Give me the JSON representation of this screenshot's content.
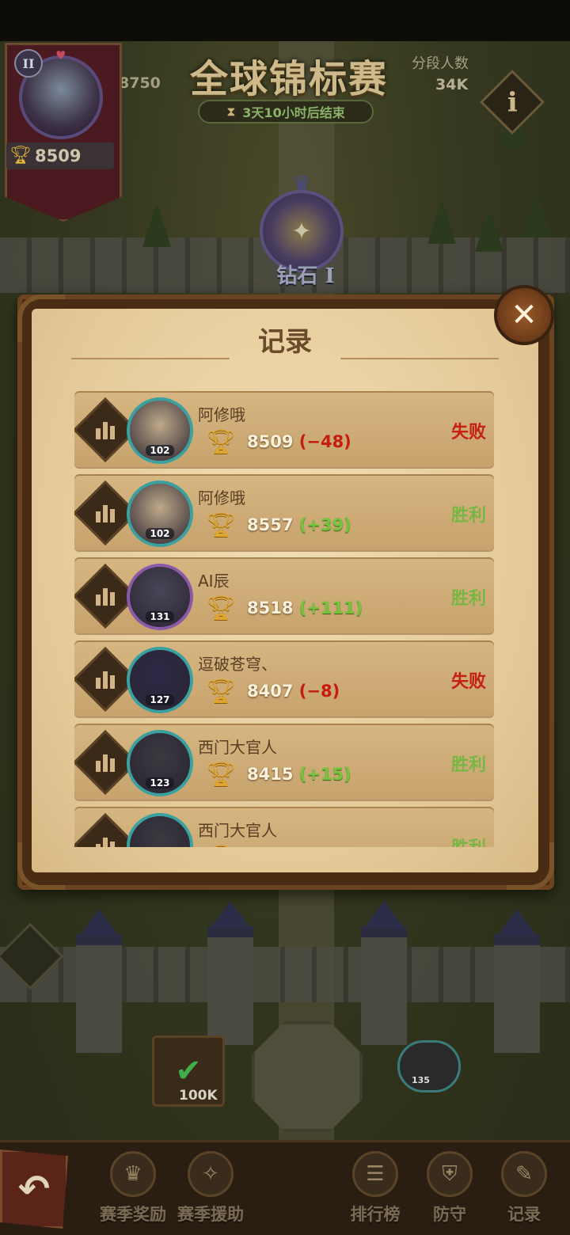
{
  "header": {
    "title": "全球锦标赛",
    "score_left": "8750",
    "rank_label": "分段人数",
    "rank_value": "34K",
    "timer": "3天10小时后结束"
  },
  "player": {
    "level_roman": "II",
    "trophies": "8509"
  },
  "league": {
    "name": "钻石 I"
  },
  "modal": {
    "title": "记录"
  },
  "records": [
    {
      "name": "阿修哦",
      "level": "102",
      "score": "8509",
      "delta": "(−48)",
      "delta_sign": "neg",
      "result": "失败",
      "avatar_color": "#bfa98a",
      "ring_color": "#3aa0a0"
    },
    {
      "name": "阿修哦",
      "level": "102",
      "score": "8557",
      "delta": "(+39)",
      "delta_sign": "pos",
      "result": "胜利",
      "avatar_color": "#bfa98a",
      "ring_color": "#3aa0a0"
    },
    {
      "name": "AI辰",
      "level": "131",
      "score": "8518",
      "delta": "(+111)",
      "delta_sign": "pos",
      "result": "胜利",
      "avatar_color": "#4a4658",
      "ring_color": "#8a5aa8"
    },
    {
      "name": "逗破苍穹、",
      "level": "127",
      "score": "8407",
      "delta": "(−8)",
      "delta_sign": "neg",
      "result": "失败",
      "avatar_color": "#2c2a48",
      "ring_color": "#3aa0a0"
    },
    {
      "name": "西门大官人",
      "level": "123",
      "score": "8415",
      "delta": "(+15)",
      "delta_sign": "pos",
      "result": "胜利",
      "avatar_color": "#3a3a40",
      "ring_color": "#3aa0a0"
    },
    {
      "name": "西门大官人",
      "level": "",
      "score": "",
      "delta": "",
      "delta_sign": "pos",
      "result": "胜利",
      "avatar_color": "#3a3a40",
      "ring_color": "#3aa0a0"
    }
  ],
  "map": {
    "chest_amount": "100K",
    "enemy_level": "135"
  },
  "nav": {
    "season_rewards": "赛季奖励",
    "season_support": "赛季援助",
    "leaderboard": "排行榜",
    "defense": "防守",
    "records": "记录"
  },
  "icons": {
    "info": "info-icon",
    "close": "close-icon",
    "trophy": "trophy-icon",
    "stats": "bar-chart-icon",
    "back": "back-arrow-icon"
  }
}
